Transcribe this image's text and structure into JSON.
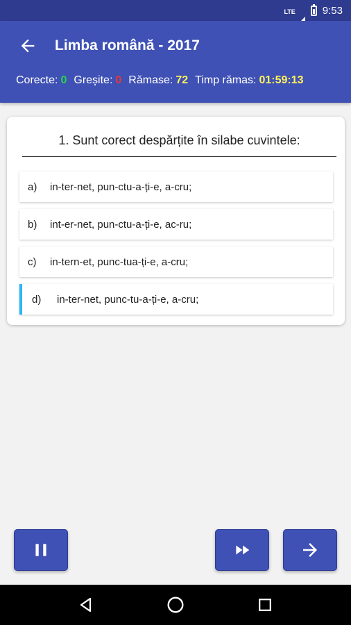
{
  "status_bar": {
    "network": "LTE",
    "time": "9:53"
  },
  "app_bar": {
    "title": "Limba română - 2017",
    "stats": {
      "correct_label": "Corecte:",
      "correct_value": "0",
      "wrong_label": "Greșite:",
      "wrong_value": "0",
      "remaining_label": "Rămase:",
      "remaining_value": "72",
      "time_label": "Timp rămas:",
      "time_value": "01:59:13"
    }
  },
  "question": {
    "text": "1. Sunt corect despărțite în silabe cuvintele:",
    "answers": [
      {
        "letter": "a)",
        "text": "in-ter-net, pun-ctu-a-ți-e, a-cru;"
      },
      {
        "letter": "b)",
        "text": "int-er-net, pun-ctu-a-ți-e, ac-ru;"
      },
      {
        "letter": "c)",
        "text": "in-tern-et, punc-tua-ți-e, a-cru;"
      },
      {
        "letter": "d)",
        "text": "in-ter-net, punc-tu-a-ți-e, a-cru;"
      }
    ],
    "selected_index": 3
  },
  "colors": {
    "primary": "#3f51b5",
    "status_bar": "#2f3b8f",
    "correct": "#27d64a",
    "wrong": "#e53935",
    "highlight": "#fff35a",
    "selection": "#29b6f6"
  },
  "icons": {
    "back": "arrow-left-icon",
    "pause": "pause-icon",
    "skip": "fast-forward-icon",
    "next": "arrow-right-icon",
    "nav_back": "triangle-back-icon",
    "nav_home": "circle-home-icon",
    "nav_recents": "square-recents-icon"
  }
}
